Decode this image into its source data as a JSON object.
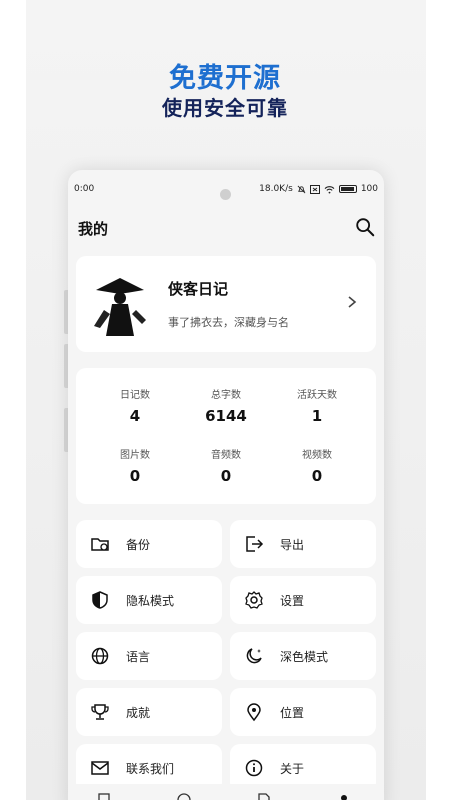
{
  "promo": {
    "headline": "免费开源",
    "subline": "使用安全可靠"
  },
  "status_bar": {
    "time": "0:00",
    "speed": "18.0K/s",
    "battery": "100"
  },
  "app_bar": {
    "title": "我的",
    "search_icon": "search-icon"
  },
  "profile": {
    "name": "侠客日记",
    "bio": "事了拂衣去，深藏身与名"
  },
  "stats": [
    {
      "label": "日记数",
      "value": "4"
    },
    {
      "label": "总字数",
      "value": "6144"
    },
    {
      "label": "活跃天数",
      "value": "1"
    },
    {
      "label": "图片数",
      "value": "0"
    },
    {
      "label": "音频数",
      "value": "0"
    },
    {
      "label": "视频数",
      "value": "0"
    }
  ],
  "menu": [
    {
      "label": "备份",
      "icon": "folder-sync-icon"
    },
    {
      "label": "导出",
      "icon": "export-icon"
    },
    {
      "label": "隐私模式",
      "icon": "shield-icon"
    },
    {
      "label": "设置",
      "icon": "gear-icon"
    },
    {
      "label": "语言",
      "icon": "globe-icon"
    },
    {
      "label": "深色模式",
      "icon": "moon-icon"
    },
    {
      "label": "成就",
      "icon": "trophy-icon"
    },
    {
      "label": "位置",
      "icon": "location-pin-icon"
    },
    {
      "label": "联系我们",
      "icon": "mail-icon"
    },
    {
      "label": "关于",
      "icon": "info-icon"
    }
  ],
  "colors": {
    "headline": "#1e6fd0",
    "subline": "#14235a",
    "background": "#f5f5f5",
    "card": "#ffffff"
  }
}
